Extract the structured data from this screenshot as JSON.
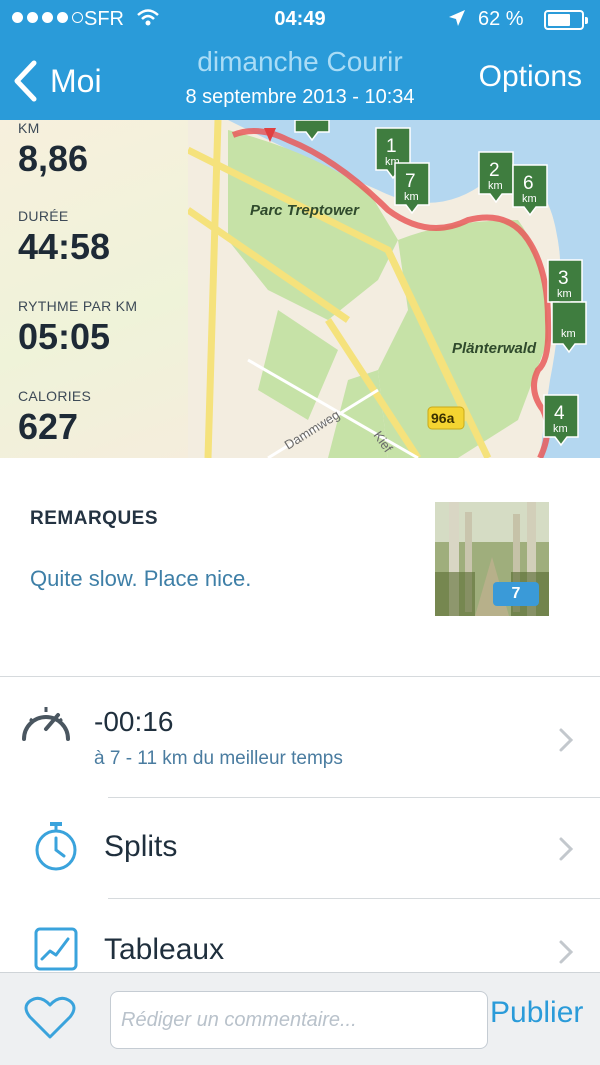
{
  "status_bar": {
    "carrier": "SFR",
    "time": "04:49",
    "battery_text": "62 %",
    "battery_level": 0.62,
    "signal_bars_filled": 4,
    "signal_bars_total": 5
  },
  "nav": {
    "back_label": "Moi",
    "title": "dimanche Courir",
    "subtitle": "8 septembre 2013 - 10:34",
    "options_label": "Options"
  },
  "stats": [
    {
      "label": "KM",
      "value": "8,86"
    },
    {
      "label": "DURÉE",
      "value": "44:58"
    },
    {
      "label": "RYTHME PAR KM",
      "value": "05:05"
    },
    {
      "label": "CALORIES",
      "value": "627"
    }
  ],
  "map": {
    "labels": {
      "park1": "Parc Treptower",
      "park2": "Plänterwald",
      "street1": "Dammweg",
      "street2": "Kief",
      "road_badge": "96a"
    },
    "km_marker_unit": "km",
    "km_markers": [
      "1",
      "7",
      "2",
      "6",
      "3",
      "4"
    ],
    "colors": {
      "water": "#b4d7f0",
      "park": "#c6e2a7",
      "route": "#e85a5a",
      "marker": "#3f7d3f",
      "road": "#f5e27c"
    }
  },
  "remarks": {
    "title": "REMARQUES",
    "text": "Quite slow. Place nice.",
    "photo_count": "7"
  },
  "best_time": {
    "delta": "-00:16",
    "detail": "à 7 - 11 km du meilleur temps"
  },
  "menu": {
    "splits": "Splits",
    "charts": "Tableaux"
  },
  "composer": {
    "placeholder": "Rédiger un commentaire...",
    "publish": "Publier"
  },
  "colors": {
    "accent": "#2a9bd9",
    "text_dark": "#1f2f3d",
    "text_blue": "#3e7fa7"
  }
}
